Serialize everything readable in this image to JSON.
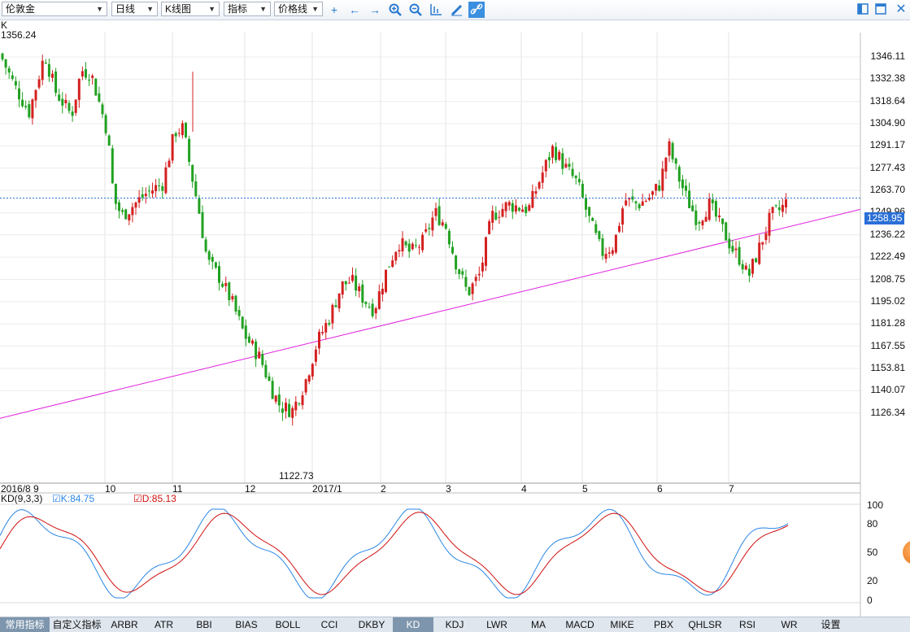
{
  "toolbar": {
    "symbol": "伦敦金",
    "period": "日线",
    "chart_type": "K线图",
    "indicator": "指标",
    "price_line": "价格线",
    "icons": [
      "crosshair-icon",
      "arrow-left-icon",
      "arrow-right-icon",
      "zoom-in-icon",
      "zoom-out-icon",
      "chart-axis-icon",
      "pen-icon",
      "link-icon"
    ],
    "right_icons": [
      "panel-left-icon",
      "panel-full-icon",
      "close-icon"
    ]
  },
  "main_chart": {
    "corner_label": "K",
    "high_label": "1356.24",
    "low_label": "1122.73",
    "current_price": "1258.95",
    "y_ticks": [
      "1346.11",
      "1332.38",
      "1318.64",
      "1304.90",
      "1291.17",
      "1277.43",
      "1263.70",
      "1249.96",
      "1236.22",
      "1222.49",
      "1208.75",
      "1195.02",
      "1181.28",
      "1167.55",
      "1153.81",
      "1140.07",
      "1126.34"
    ],
    "x_ticks": [
      "2016/8 9",
      "10",
      "11",
      "12",
      "2017/1",
      "2",
      "3",
      "4",
      "5",
      "6",
      "7"
    ]
  },
  "kd_panel": {
    "title": "KD(9,3,3)",
    "k_label": "K:84.75",
    "d_label": "D:85.13",
    "y_ticks": [
      "100",
      "80",
      "50",
      "20",
      "0"
    ]
  },
  "tabs": [
    "常用指标",
    "自定义指标",
    "ARBR",
    "ATR",
    "BBI",
    "BIAS",
    "BOLL",
    "CCI",
    "DKBY",
    "KD",
    "KDJ",
    "LWR",
    "MA",
    "MACD",
    "MIKE",
    "PBX",
    "QHLSR",
    "RSI",
    "WR",
    "设置"
  ],
  "active_tab": "KD",
  "colors": {
    "up": "#d42020",
    "down": "#21a121",
    "k_line": "#2a86e6",
    "d_line": "#d01010",
    "trend": "#e020e0",
    "price_line": "#2a6fd6"
  },
  "chart_data": {
    "type": "candlestick",
    "series": [
      {
        "name": "K",
        "values": []
      },
      {
        "name": "D",
        "values": []
      }
    ],
    "ylim": [
      1120,
      1358
    ],
    "trendline": [
      [
        0,
        1122
      ],
      [
        220,
        1252
      ]
    ],
    "current_price": 1258.95,
    "high": 1356.24,
    "low": 1122.73
  }
}
